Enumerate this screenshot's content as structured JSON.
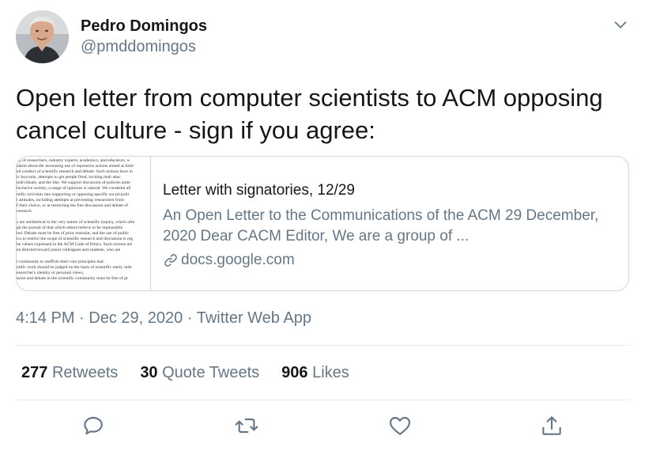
{
  "author": {
    "name": "Pedro Domingos",
    "handle": "@pmddomingos"
  },
  "tweet": {
    "text": "Open letter from computer scientists to ACM opposing cancel culture - sign if you agree:"
  },
  "card": {
    "title": "Letter with signatories, 12/29",
    "description": "An Open Letter to the Communications of the ACM 29 December, 2020 Dear CACM Editor, We are a group of ...",
    "domain": "docs.google.com",
    "thumbnail_lines": [
      "up of researchers, industry experts, academics, and educators, w",
      "alarm about the increasing use of repressive actions aimed at limit",
      "ed conduct of scientific research and debate. Such actions have in",
      "ic boycotts, attempts to get people fired, inviting mob attac",
      " individuals, and the like. We support discussion of policies aime",
      " inclusive society; a range of opinions is natural. We condemn all",
      "ntific activities into supporting or opposing specific social-polit",
      "l attitudes, including attempts at preventing researchers from",
      "f their choice, or at restricting the free discussion and debate of",
      " research.",
      "",
      "s are antithetical to the very nature of scientific inquiry, which ofte",
      "gh the pursuit of that which others believe to be implausible",
      "led. Debate must be free of prior restraint, and the use of public",
      "ics to restrict the scope of scientific research and discussion is reg",
      "he values expressed in the ACM Code of Ethics. Such actions are",
      "en directed toward junior colleagues and students, who are",
      "",
      "t community to reaffirm their core principles that:",
      "ntific work should be judged on the basis of scientific merit, inde",
      "esearcher's identity or personal views,",
      "ssion and debate in the scientific community must be free of pr"
    ]
  },
  "meta": {
    "time": "4:14 PM",
    "separator": "·",
    "date": "Dec 29, 2020",
    "source": "Twitter Web App"
  },
  "stats": {
    "retweets": {
      "count": "277",
      "label": "Retweets"
    },
    "quote_tweets": {
      "count": "30",
      "label": "Quote Tweets"
    },
    "likes": {
      "count": "906",
      "label": "Likes"
    }
  },
  "colors": {
    "text_primary": "#14171a",
    "text_secondary": "#657786",
    "border": "#ccd6dd",
    "divider": "#e6ecf0"
  },
  "icons": {
    "caret": "chevron-down-icon",
    "link": "link-icon",
    "reply": "reply-icon",
    "retweet": "retweet-icon",
    "like": "heart-icon",
    "share": "share-icon"
  }
}
